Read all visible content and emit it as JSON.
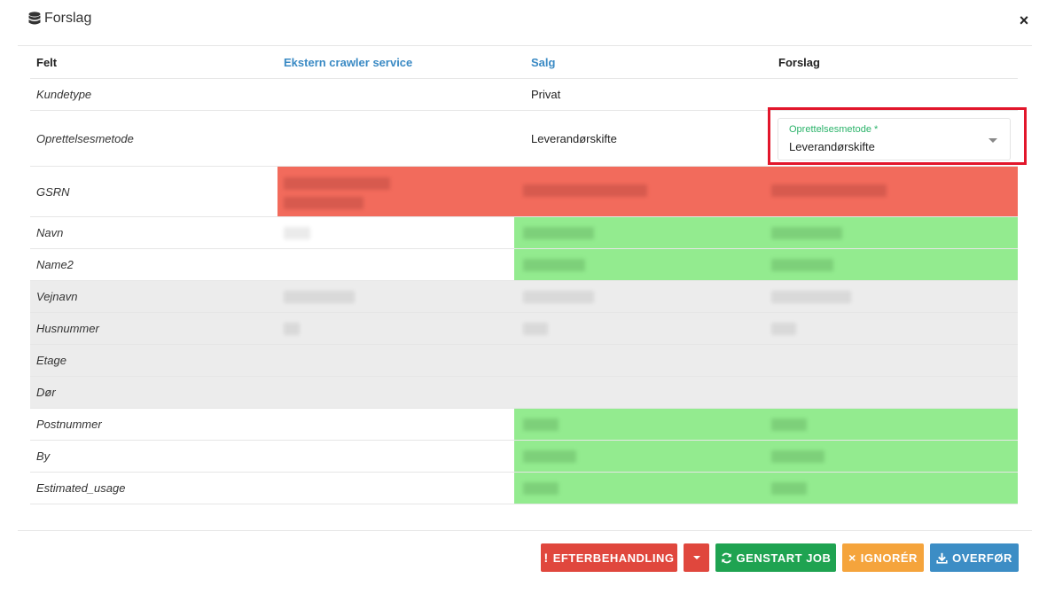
{
  "modal": {
    "title": "Forslag",
    "close_label": "×"
  },
  "table": {
    "headers": [
      "Felt",
      "Ekstern crawler service",
      "Salg",
      "Forslag"
    ],
    "rows": [
      {
        "label": "Kundetype",
        "salg": "Privat"
      },
      {
        "label": "Oprettelsesmetode",
        "salg": "Leverandørskifte"
      },
      {
        "label": "GSRN"
      },
      {
        "label": "Navn"
      },
      {
        "label": "Name2"
      },
      {
        "label": "Vejnavn"
      },
      {
        "label": "Husnummer"
      },
      {
        "label": "Etage"
      },
      {
        "label": "Dør"
      },
      {
        "label": "Postnummer"
      },
      {
        "label": "By"
      },
      {
        "label": "Estimated_usage"
      }
    ]
  },
  "select": {
    "label": "Oprettelsesmetode *",
    "value": "Leverandørskifte"
  },
  "buttons": {
    "efterbehandling": "EFTERBEHANDLING",
    "efterbehandling_icon": "!",
    "genstart": "GENSTART JOB",
    "ignorer": "IGNORÉR",
    "ignorer_icon": "×",
    "overfor": "OVERFØR"
  },
  "colors": {
    "conflict": "#f26b5c",
    "match": "#93eb8f",
    "neutral": "#ececec",
    "highlight_outline": "#e2162b"
  }
}
